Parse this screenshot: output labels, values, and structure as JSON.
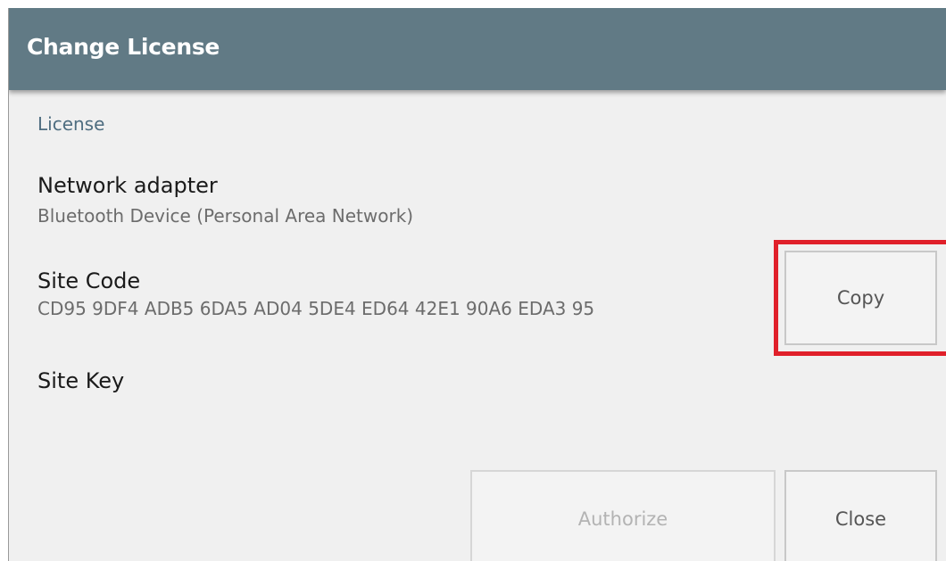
{
  "dialog": {
    "title": "Change License",
    "section_label": "License",
    "network_adapter": {
      "label": "Network adapter",
      "value": "Bluetooth Device (Personal Area Network)"
    },
    "site_code": {
      "label": "Site Code",
      "value": "CD95 9DF4 ADB5 6DA5 AD04 5DE4 ED64 42E1 90A6 EDA3 95"
    },
    "site_key": {
      "label": "Site Key"
    },
    "buttons": {
      "copy": "Copy",
      "authorize": "Authorize",
      "close": "Close"
    }
  },
  "colors": {
    "titlebar": "#617a85",
    "highlight": "#e0202a"
  }
}
